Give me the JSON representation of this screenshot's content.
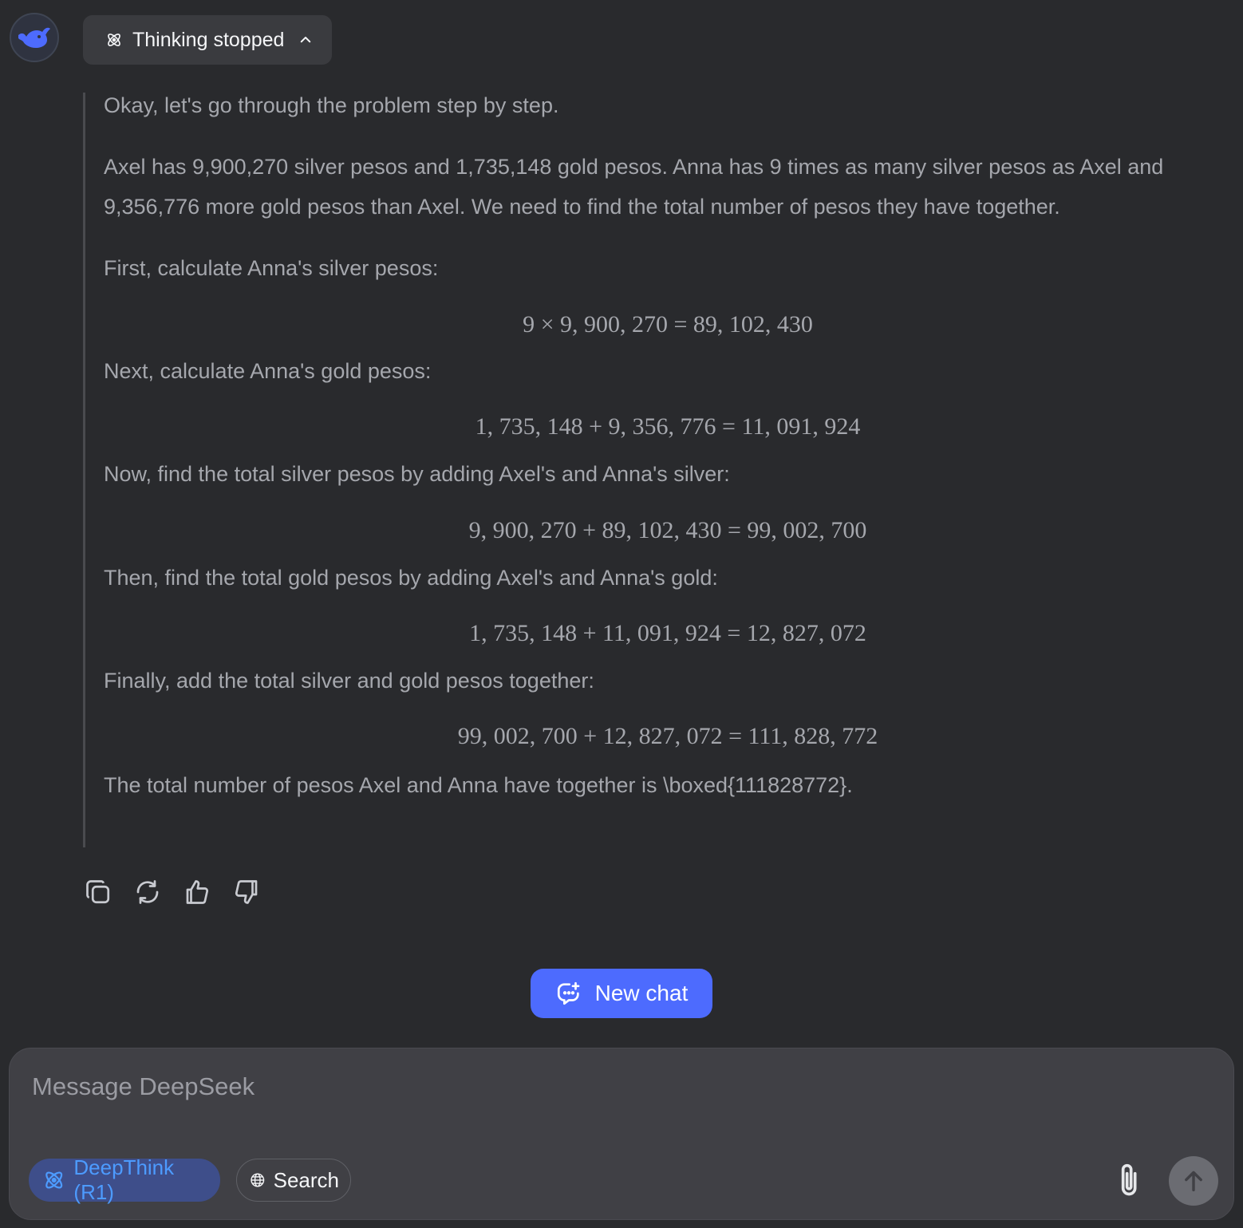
{
  "header": {
    "avatar_icon": "deepseek-whale-icon",
    "thinking_label": "Thinking stopped"
  },
  "thought": {
    "lines": [
      "Okay, let's go through the problem step by step.",
      "Axel has 9,900,270 silver pesos and 1,735,148 gold pesos. Anna has 9 times as many silver pesos as Axel and",
      "9,356,776 more gold pesos than Axel. We need to find the total number of pesos they have together.",
      "First, calculate Anna's silver pesos:",
      "9 × 9, 900, 270 = 89, 102, 430",
      "Next, calculate Anna's gold pesos:",
      "1, 735, 148 + 9, 356, 776 = 11, 091, 924",
      "Now, find the total silver pesos by adding Axel's and Anna's silver:",
      "9, 900, 270 + 89, 102, 430 = 99, 002, 700",
      "Then, find the total gold pesos by adding Axel's and Anna's gold:",
      "1, 735, 148 + 11, 091, 924 = 12, 827, 072",
      "Finally, add the total silver and gold pesos together:",
      "99, 002, 700 + 12, 827, 072 = 111, 828, 772",
      "The total number of pesos Axel and Anna have together is \\boxed{111828772}."
    ]
  },
  "actions": {
    "icons": [
      "copy-icon",
      "regenerate-icon",
      "thumbs-up-icon",
      "thumbs-down-icon"
    ]
  },
  "new_chat": {
    "label": "New chat"
  },
  "composer": {
    "placeholder": "Message DeepSeek",
    "deepthink_label": "DeepThink (R1)",
    "search_label": "Search"
  },
  "colors": {
    "background": "#292a2d",
    "accent": "#4d6bfe",
    "thought_text": "#a5a7ad",
    "deepthink_active": "#4d9bff"
  }
}
